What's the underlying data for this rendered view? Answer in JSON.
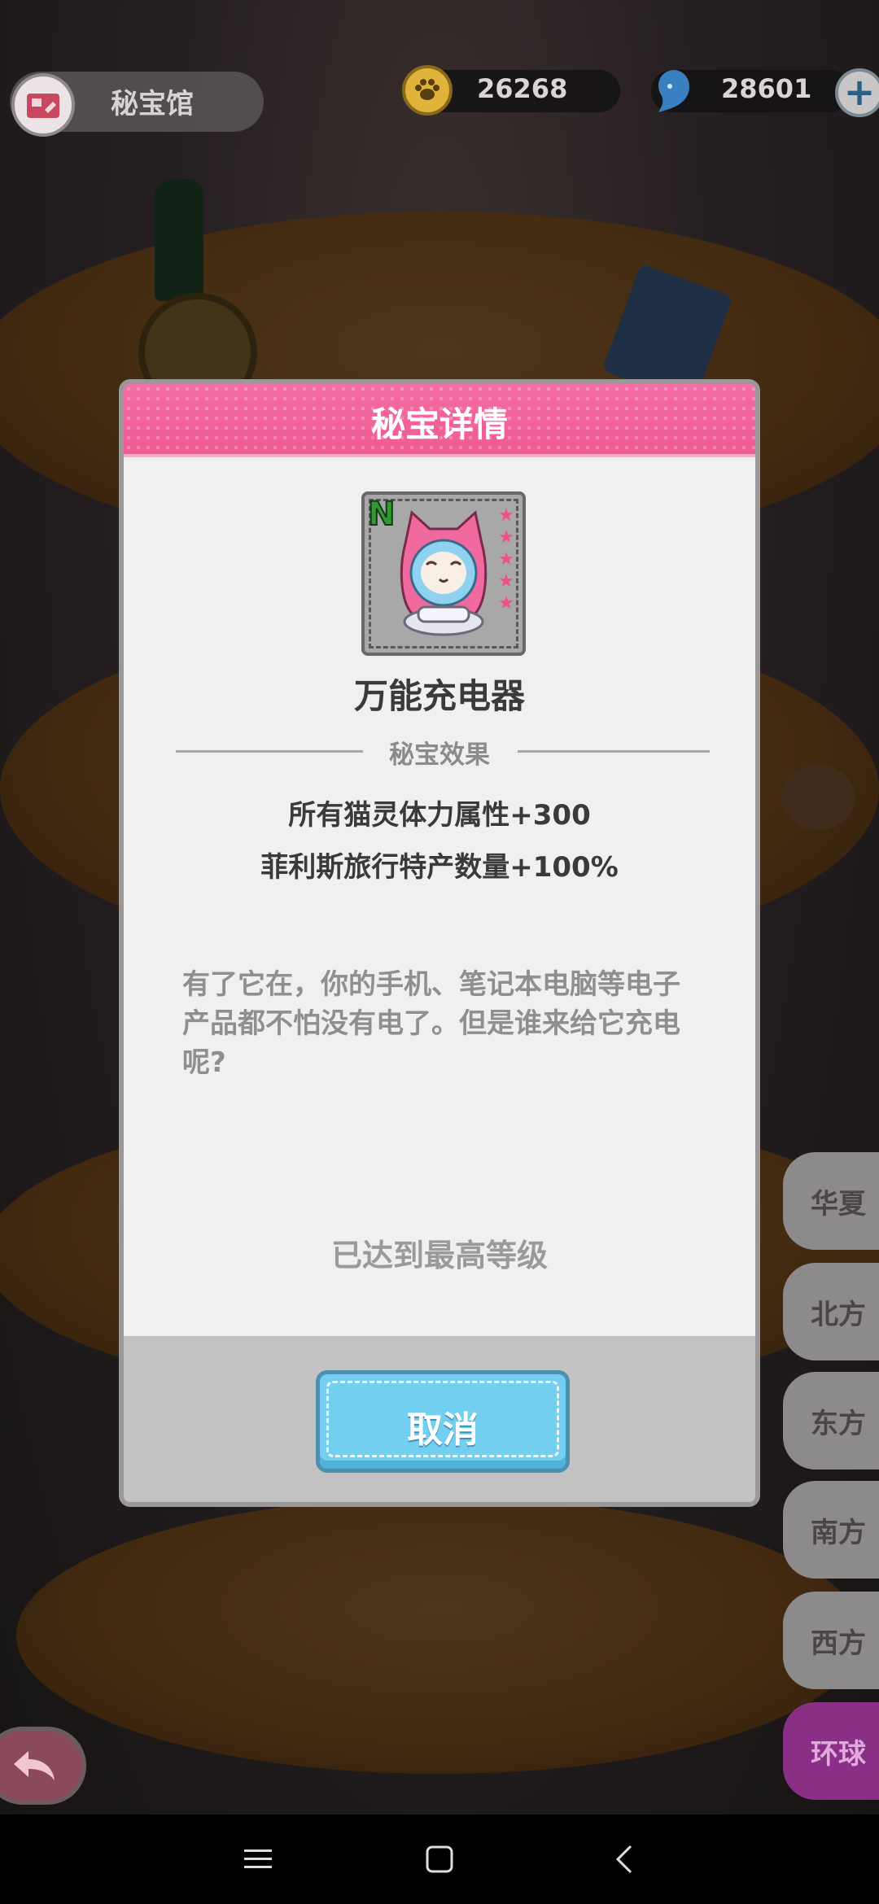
{
  "header": {
    "title": "秘宝馆",
    "coins": "26268",
    "gems": "28601",
    "plus_symbol": "+"
  },
  "regions": [
    {
      "label": "华夏",
      "active": false
    },
    {
      "label": "北方",
      "active": false
    },
    {
      "label": "东方",
      "active": false
    },
    {
      "label": "南方",
      "active": false
    },
    {
      "label": "西方",
      "active": false
    },
    {
      "label": "环球",
      "active": true
    }
  ],
  "dialog": {
    "title": "秘宝详情",
    "item": {
      "rarity": "N",
      "stars": 5,
      "name": "万能充电器"
    },
    "effect_heading": "秘宝效果",
    "effects": [
      "所有猫灵体力属性+300",
      "菲利斯旅行特产数量+100%"
    ],
    "description": "有了它在，你的手机、笔记本电脑等电子产品都不怕没有电了。但是谁来给它充电呢?",
    "status": "已达到最高等级",
    "cancel_label": "取消"
  },
  "colors": {
    "header_pink": "#ef5a93",
    "cancel_blue": "#72cff0",
    "active_tab": "#8a2f86"
  }
}
